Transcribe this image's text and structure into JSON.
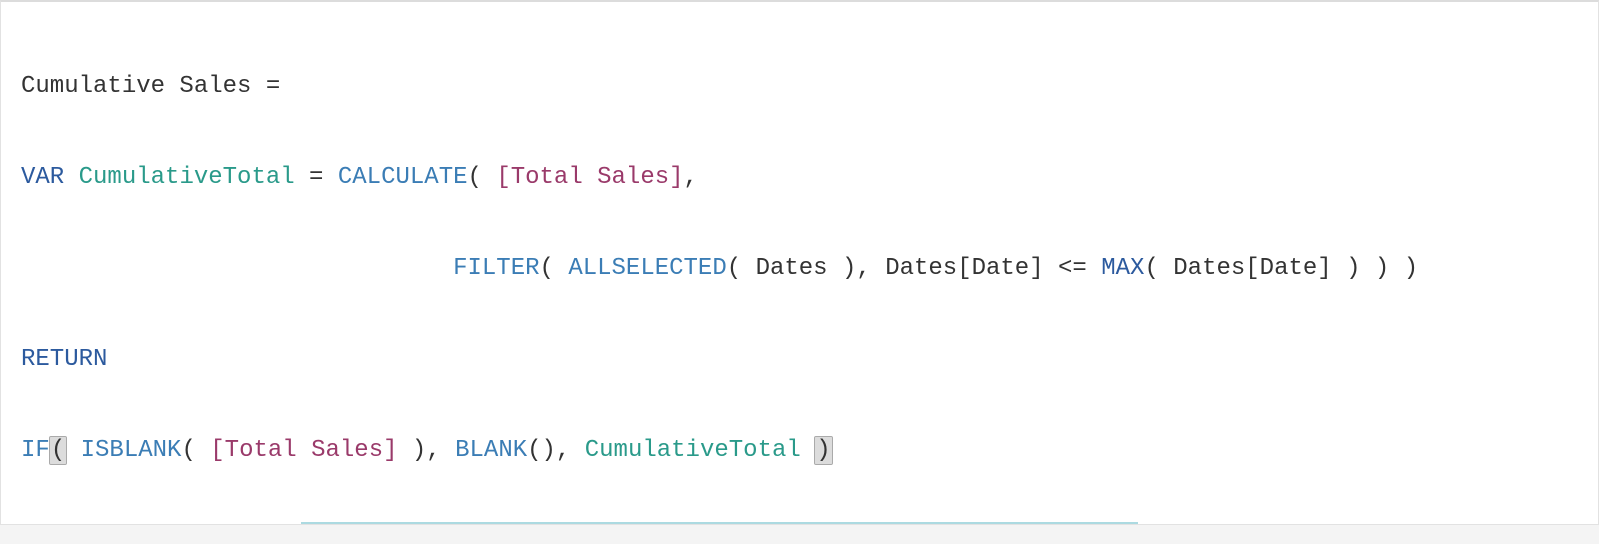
{
  "formula": {
    "line1": {
      "measureName": "Cumulative Sales",
      "equals": " ="
    },
    "line2": {
      "var": "VAR",
      "varName": " CumulativeTotal",
      "eq": " = ",
      "calculate": "CALCULATE",
      "openParen": "( ",
      "measureRef": "[Total Sales]",
      "comma": ","
    },
    "line3": {
      "indent": "                              ",
      "filter": "FILTER",
      "p1": "( ",
      "allselected": "ALLSELECTED",
      "p2": "( ",
      "tbl": "Dates",
      "p3": " ), ",
      "col": "Dates[Date]",
      "op": " <= ",
      "max": "MAX",
      "p4": "( ",
      "col2": "Dates[Date]",
      "p5": " ) ) )"
    },
    "line4": {
      "return": "RETURN"
    },
    "line5": {
      "if": "IF",
      "openParen": "(",
      "space1": " ",
      "isblank": "ISBLANK",
      "p1": "( ",
      "measureRef": "[Total Sales]",
      "p2": " ), ",
      "blank": "BLANK",
      "p3": "(), ",
      "varRef": "CumulativeTotal",
      "space2": " ",
      "closeParen": ")"
    }
  }
}
